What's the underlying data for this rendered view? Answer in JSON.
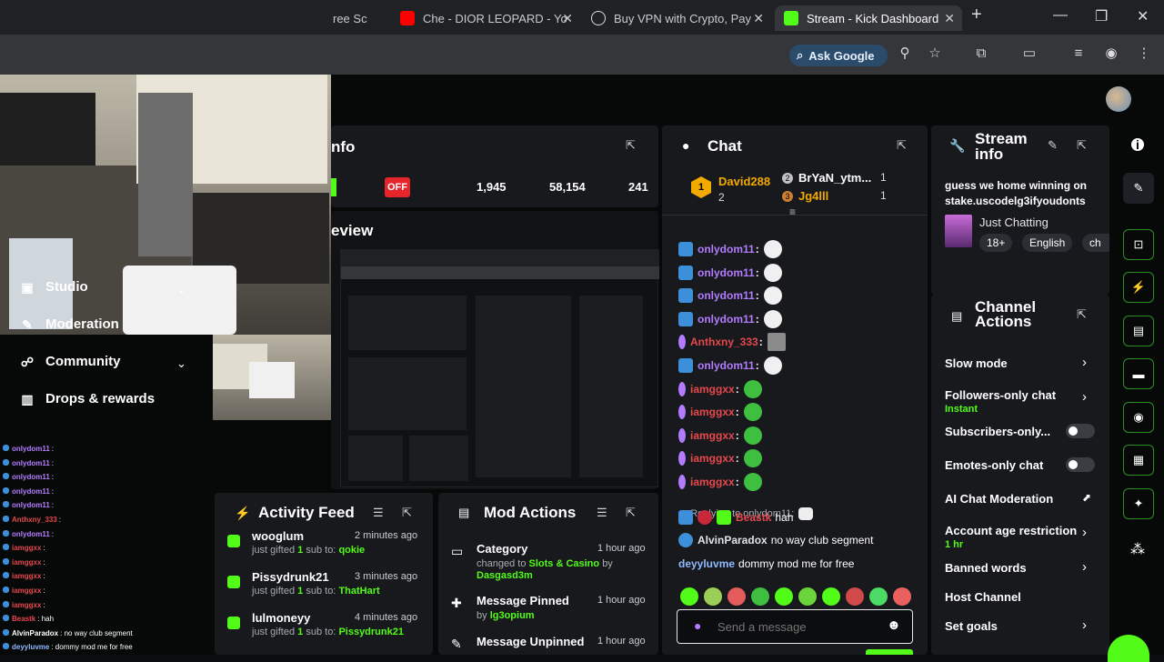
{
  "tabs": [
    {
      "label": "ree Sc",
      "icon": "tab-icon"
    },
    {
      "label": "Che - DIOR LEOPARD - Yo",
      "icon": "youtube-icon",
      "color": "#ff0000"
    },
    {
      "label": "Buy VPN with Crypto, Pay",
      "icon": "vpn-icon",
      "color": "#ffffff"
    },
    {
      "label": "Stream - Kick Dashboard",
      "icon": "kick-icon",
      "color": "#53fc18"
    }
  ],
  "toolbar": {
    "ask_google": "Ask Google"
  },
  "nav": {
    "studio": "Studio",
    "moderation": "Moderation",
    "community": "Community",
    "drops": "Drops & rewards"
  },
  "stream_info_left": {
    "title_fragment": "nfo",
    "preview_fragment": "eview",
    "status": "OFF",
    "stats": [
      "1,945",
      "58,154",
      "241"
    ]
  },
  "activity_feed": {
    "title": "Activity Feed",
    "items": [
      {
        "user": "wooglum",
        "time": "2 minutes ago",
        "prefix": "just gifted",
        "count": "1",
        "suffix": "sub to:",
        "target": "qokie"
      },
      {
        "user": "Pissydrunk21",
        "time": "3 minutes ago",
        "prefix": "just gifted",
        "count": "1",
        "suffix": "sub to:",
        "target": "ThatHart"
      },
      {
        "user": "lulmoneyy",
        "time": "4 minutes ago",
        "prefix": "just gifted",
        "count": "1",
        "suffix": "sub to:",
        "target": "Pissydrunk21"
      }
    ]
  },
  "mod_actions": {
    "title": "Mod Actions",
    "items": [
      {
        "action": "Category",
        "time": "1 hour ago",
        "prefix": "changed to",
        "value": "Slots & Casino",
        "by": "by",
        "user": "Dasgasd3m"
      },
      {
        "action": "Message Pinned",
        "time": "1 hour ago",
        "by": "by",
        "user": "lg3opium"
      },
      {
        "action": "Message Unpinned",
        "time": "1 hour ago"
      }
    ]
  },
  "chat": {
    "title": "Chat",
    "leaders": [
      {
        "rank": "1",
        "name": "David288",
        "count": "2"
      },
      {
        "rank": "2",
        "name": "BrYaN_ytm...",
        "count": "1"
      },
      {
        "rank": "3",
        "name": "Jg4lll",
        "count": "1"
      }
    ],
    "messages": [
      {
        "user": "onlydom11",
        "color": "#b37cff"
      },
      {
        "user": "onlydom11",
        "color": "#b37cff"
      },
      {
        "user": "onlydom11",
        "color": "#b37cff"
      },
      {
        "user": "onlydom11",
        "color": "#b37cff"
      },
      {
        "user": "Anthxny_333",
        "color": "#e5484d"
      },
      {
        "user": "onlydom11",
        "color": "#b37cff"
      },
      {
        "user": "iamggxx",
        "color": "#e5484d"
      },
      {
        "user": "iamggxx",
        "color": "#e5484d"
      },
      {
        "user": "iamggxx",
        "color": "#e5484d"
      },
      {
        "user": "iamggxx",
        "color": "#e5484d"
      },
      {
        "user": "iamggxx",
        "color": "#e5484d"
      }
    ],
    "reply_label": "Replying to onlydom11:",
    "msg_beastk_user": "Beastk",
    "msg_beastk_text": "hah",
    "msg_alvin_user": "AlvinParadox",
    "msg_alvin_text": "no way club segment",
    "msg_deyy_user": "deyyluvme",
    "msg_deyy_text": "dommy mod me for free",
    "send_placeholder": "Send a message"
  },
  "stream_info": {
    "title": "Stream info",
    "stream_title": "guess we home winning on stake.uscodelg3ifyoudonts",
    "category": "Just Chatting",
    "tags": [
      "18+",
      "English",
      "ch"
    ]
  },
  "channel_actions": {
    "title": "Channel Actions",
    "rows": [
      {
        "label": "Slow mode",
        "sub": "",
        "control": "arrow"
      },
      {
        "label": "Followers-only chat",
        "sub": "Instant",
        "control": "arrow"
      },
      {
        "label": "Subscribers-only...",
        "sub": "",
        "control": "toggle"
      },
      {
        "label": "Emotes-only chat",
        "sub": "",
        "control": "toggle"
      },
      {
        "label": "AI Chat Moderation",
        "sub": "",
        "control": "chart"
      },
      {
        "label": "Account age restriction",
        "sub": "1 hr",
        "control": "arrow"
      },
      {
        "label": "Banned words",
        "sub": "",
        "control": "arrow"
      },
      {
        "label": "Host Channel",
        "sub": "",
        "control": "none"
      },
      {
        "label": "Set goals",
        "sub": "",
        "control": "arrow"
      }
    ]
  },
  "mini_chat": [
    {
      "user": "onlydom11",
      "text": ":",
      "color": "#b37cff"
    },
    {
      "user": "onlydom11",
      "text": ":",
      "color": "#b37cff"
    },
    {
      "user": "onlydom11",
      "text": ":",
      "color": "#b37cff"
    },
    {
      "user": "onlydom11",
      "text": ":",
      "color": "#b37cff"
    },
    {
      "user": "onlydom11",
      "text": ":",
      "color": "#b37cff"
    },
    {
      "user": "Anthxny_333",
      "text": ":",
      "color": "#e5484d"
    },
    {
      "user": "onlydom11",
      "text": ":",
      "color": "#b37cff"
    },
    {
      "user": "iamggxx",
      "text": ":",
      "color": "#e5484d"
    },
    {
      "user": "iamggxx",
      "text": ":",
      "color": "#e5484d"
    },
    {
      "user": "iamggxx",
      "text": ":",
      "color": "#e5484d"
    },
    {
      "user": "iamggxx",
      "text": ":",
      "color": "#e5484d"
    },
    {
      "user": "iamggxx",
      "text": ":",
      "color": "#e5484d"
    },
    {
      "user": "Beastk",
      "text": ": hah",
      "color": "#e5484d"
    },
    {
      "user": "AlvinParadox",
      "text": ": no way club segment",
      "color": "#ffffff"
    },
    {
      "user": "deyyluvme",
      "text": ": dommy mod me for free",
      "color": "#8fb8ff"
    }
  ],
  "colors": {
    "accent": "#53fc18",
    "off": "#e5242c",
    "panel": "#17191c"
  }
}
